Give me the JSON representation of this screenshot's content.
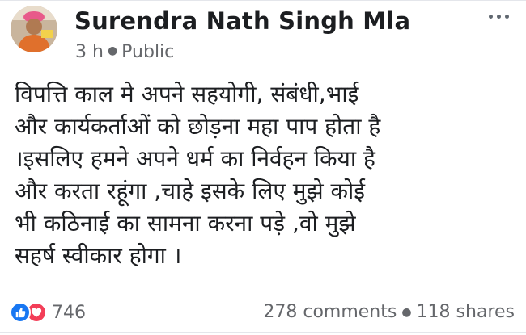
{
  "post": {
    "author": "Surendra Nath Singh Mla",
    "time": "3 h",
    "visibility": "Public",
    "lines": [
      "विपत्ति काल मे अपने सहयोगी, संबंधी,भाई",
      "और कार्यकर्ताओं को छोड़ना महा पाप होता है",
      "।इसलिए हमने अपने धर्म का निर्वहन किया है",
      "और करता रहूंगा ,चाहे इसके लिए मुझे कोई",
      "भी कठिनाई का सामना करना पड़े ,वो मुझे",
      "सहर्ष स्वीकार होगा ।"
    ]
  },
  "engagement": {
    "reaction_count": "746",
    "comments": "278 comments",
    "shares": "118 shares"
  },
  "icons": {
    "more": "more-options-icon",
    "like": "like-reaction-icon",
    "love": "love-reaction-icon",
    "globe": "public-globe"
  },
  "colors": {
    "like": "#1877f2",
    "love": "#f33e58",
    "secondary_text": "#65676b"
  }
}
